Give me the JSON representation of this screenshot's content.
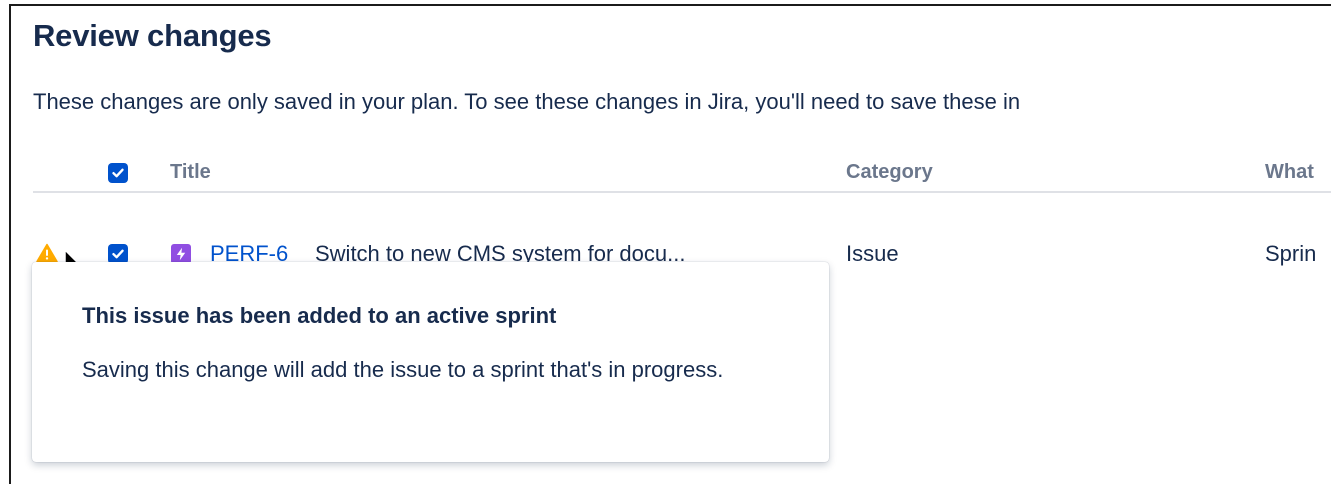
{
  "dialog": {
    "title": "Review changes",
    "description": "These changes are only saved in your plan. To see these changes in Jira, you'll need to save these in"
  },
  "table": {
    "headers": {
      "title": "Title",
      "category": "Category",
      "what": "What"
    },
    "rows": [
      {
        "warning_icon": "warning-icon",
        "selected": true,
        "issue_type_icon": "epic-lightning-icon",
        "key": "PERF-6",
        "summary": "Switch to new CMS system for docu...",
        "category": "Issue",
        "what": "Sprin"
      }
    ]
  },
  "tooltip": {
    "title": "This issue has been added to an active sprint",
    "body": "Saving this change will add the issue to a sprint that's in progress."
  },
  "colors": {
    "primary": "#0052CC",
    "text": "#172B4D",
    "subtle_text": "#6B778C",
    "warning": "#FFAB00",
    "epic": "#904EE2"
  }
}
